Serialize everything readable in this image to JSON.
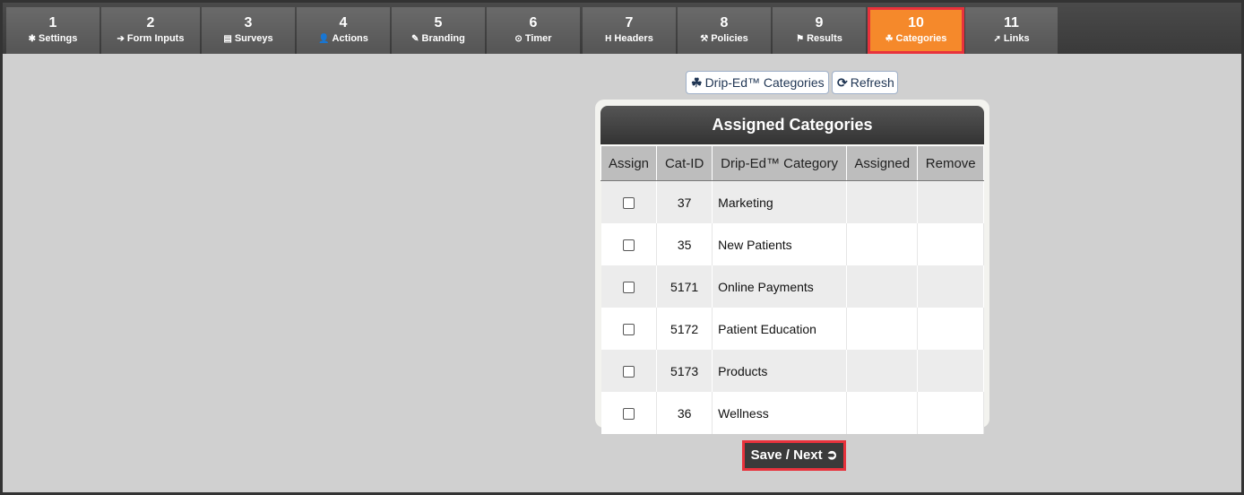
{
  "tabs": [
    {
      "num": "1",
      "label": "Settings",
      "icon": "✱"
    },
    {
      "num": "2",
      "label": "Form Inputs",
      "icon": "➔"
    },
    {
      "num": "3",
      "label": "Surveys",
      "icon": "▤"
    },
    {
      "num": "4",
      "label": "Actions",
      "icon": "👤"
    },
    {
      "num": "5",
      "label": "Branding",
      "icon": "✎"
    },
    {
      "num": "6",
      "label": "Timer",
      "icon": "⊙"
    },
    {
      "num": "7",
      "label": "Headers",
      "icon": "H"
    },
    {
      "num": "8",
      "label": "Policies",
      "icon": "⚒"
    },
    {
      "num": "9",
      "label": "Results",
      "icon": "⚑"
    },
    {
      "num": "10",
      "label": "Categories",
      "icon": "☘"
    },
    {
      "num": "11",
      "label": "Links",
      "icon": "➚"
    }
  ],
  "active_tab": "10",
  "toolbar": {
    "categories_btn": "Drip-Ed™ Categories",
    "refresh_btn": "Refresh"
  },
  "panel": {
    "title": "Assigned Categories",
    "columns": [
      "Assign",
      "Cat-ID",
      "Drip-Ed™ Category",
      "Assigned",
      "Remove"
    ],
    "rows": [
      {
        "id": "37",
        "name": "Marketing"
      },
      {
        "id": "35",
        "name": "New Patients"
      },
      {
        "id": "5171",
        "name": "Online Payments"
      },
      {
        "id": "5172",
        "name": "Patient Education"
      },
      {
        "id": "5173",
        "name": "Products"
      },
      {
        "id": "36",
        "name": "Wellness"
      }
    ]
  },
  "save_btn": "Save / Next",
  "colors": {
    "active_tab": "#f5892b",
    "highlight": "#e8323c",
    "accent_text": "#1f3553"
  }
}
